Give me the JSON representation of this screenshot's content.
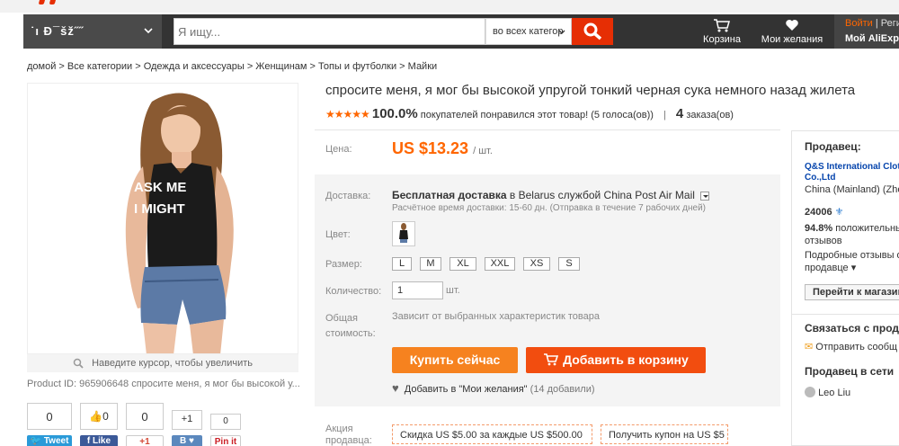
{
  "header": {
    "category_label": "˙ı Ð¯šž˝˝",
    "search_placeholder": "Я ищу...",
    "search_category": "во всех категор",
    "cart_label": "Корзина",
    "wishlist_label": "Мои желания",
    "login_label": "Войти",
    "register_label": "| Реги",
    "account_label": "Мой AliExpre",
    "icons": {
      "search": "search-icon",
      "cart": "cart-icon",
      "wishlist": "heart-icon"
    },
    "colors": {
      "accent": "#e62e04",
      "bar": "#333333"
    }
  },
  "breadcrumb": "домой > Все категории > Одежда и аксессуары > Женщинам > Топы и футболки > Майки",
  "gallery": {
    "zoom_hint": "Наведите курсор, чтобы увеличить",
    "product_id": "Product ID: 965906648 спросите меня, я мог бы высокой у...",
    "shirt_text_1": "ASK ME",
    "shirt_text_2": "I MIGHT"
  },
  "social": {
    "counts": [
      "0",
      "0",
      "0",
      "+1",
      "0"
    ],
    "buttons": [
      "Tweet",
      "Like",
      "+1",
      "B",
      "Pin it"
    ]
  },
  "product": {
    "title": "спросите меня, я мог бы высокой упругой тонкий черная сука немного назад жилета",
    "stars": "★★★★★",
    "rating_pct": "100.0%",
    "rating_text": "покупателей понравился этот товар! (5 голоса(ов))",
    "orders_count": "4",
    "orders_label": "заказа(ов)",
    "price_label": "Цена:",
    "price": "US $13.23",
    "price_unit": "/ шт.",
    "shipping_label": "Доставка:",
    "shipping_free": "Бесплатная доставка",
    "shipping_rest": " в  Belarus службой China Post Air Mail",
    "shipping_time": "Расчётное время доставки: 15-60 дн. (Отправка в течение 7 рабочих дней)",
    "color_label": "Цвет:",
    "size_label": "Размер:",
    "sizes": [
      "L",
      "M",
      "XL",
      "XXL",
      "XS",
      "S"
    ],
    "qty_label": "Количество:",
    "qty_value": "1",
    "qty_unit": "шт.",
    "total_label_1": "Общая",
    "total_label_2": "стоимость:",
    "total_note": "Зависит от выбранных характеристик товара",
    "buy_now": "Купить сейчас",
    "add_cart": "Добавить в корзину",
    "wish_text": "Добавить в \"Мои желания\"",
    "wish_count": "(14 добавили)",
    "promo_label_1": "Акция",
    "promo_label_2": "продавца:",
    "coupon_1": "Скидка US $5.00 за каждые US $500.00",
    "coupon_2": "Получить купон на US $5"
  },
  "seller": {
    "heading": "Продавец:",
    "name_1": "Q&S International Clot",
    "name_2": "Co.,Ltd",
    "location": "China (Mainland) (Zhe",
    "score": "24006",
    "positive_pct": "94.8%",
    "positive_text_1": "положительны",
    "positive_text_2": "отзывов",
    "details_1": "Подробные отзывы о",
    "details_2": "продавце",
    "store_btn": "Перейти к магазину",
    "contact_heading": "Связаться с прод",
    "send_message": "Отправить сообщ",
    "network_heading": "Продавец в сети",
    "online_name": "Leo Liu"
  }
}
